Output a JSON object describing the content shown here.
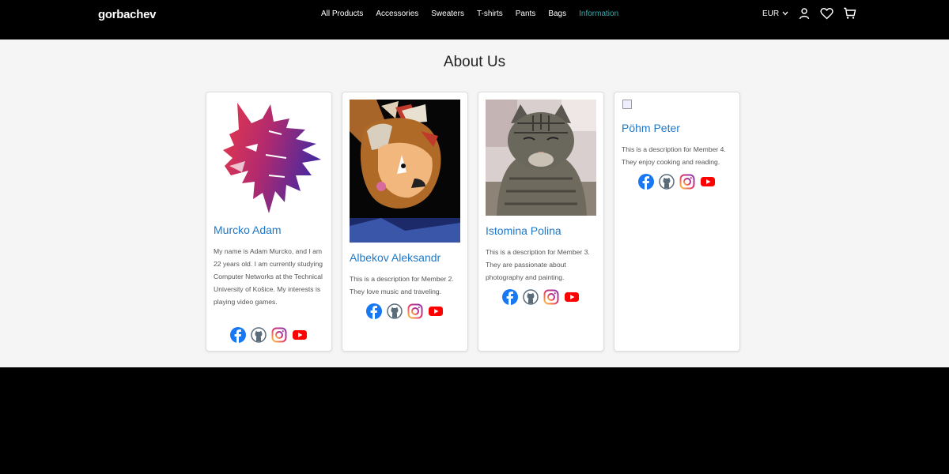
{
  "header": {
    "brand": "gorbachev",
    "nav": [
      {
        "label": "All Products",
        "active": false
      },
      {
        "label": "Accessories",
        "active": false
      },
      {
        "label": "Sweaters",
        "active": false
      },
      {
        "label": "T-shirts",
        "active": false
      },
      {
        "label": "Pants",
        "active": false
      },
      {
        "label": "Bags",
        "active": false
      },
      {
        "label": "Information",
        "active": true
      }
    ],
    "currency": "EUR",
    "icons": [
      "user-icon",
      "heart-icon",
      "cart-icon"
    ]
  },
  "page": {
    "title": "About Us"
  },
  "members": [
    {
      "name": "Murcko Adam",
      "description": "My name is Adam Murcko, and I am 22 years old. I am currently studying Computer Networks at the Technical University of Košice. My interests is playing video games.",
      "photo": "wolf-logo"
    },
    {
      "name": "Albekov Aleksandr",
      "description": "This is a description for Member 2. They love music and traveling.",
      "photo": "cartoon-character"
    },
    {
      "name": "Istomina Polina",
      "description": "This is a description for Member 3. They are passionate about photography and painting.",
      "photo": "tabby-cat"
    },
    {
      "name": "Pöhm Peter",
      "description": "This is a description for Member 4. They enjoy cooking and reading.",
      "photo": "broken-image"
    }
  ],
  "social_icons": [
    "facebook-icon",
    "github-icon",
    "instagram-icon",
    "youtube-icon"
  ],
  "colors": {
    "accent": "#2bb3b9",
    "name_link": "#1e78c8",
    "facebook": "#1877f2",
    "youtube": "#ff0000"
  }
}
